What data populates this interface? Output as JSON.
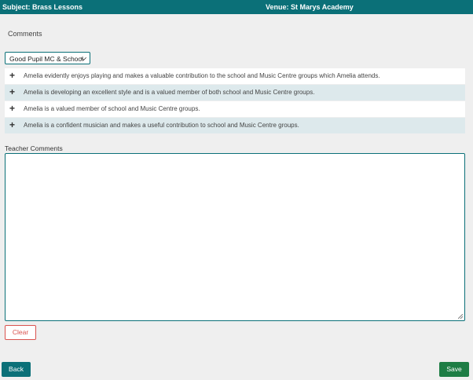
{
  "header": {
    "subject": "Subject: Brass Lessons",
    "venue": "Venue: St Marys Academy"
  },
  "comments": {
    "heading": "Comments",
    "select_value": "Good Pupil MC & School",
    "items": [
      {
        "text": "Amelia evidently enjoys playing and makes a valuable contribution to the school and Music Centre groups which Amelia attends."
      },
      {
        "text": "Amelia is developing an excellent style and is a valued member of both school and Music Centre groups."
      },
      {
        "text": "Amelia is a valued member of school and Music Centre groups."
      },
      {
        "text": "Amelia is a confident musician and makes a useful contribution to school and Music Centre groups."
      }
    ]
  },
  "teacher_comments": {
    "label": "Teacher Comments",
    "value": ""
  },
  "buttons": {
    "clear": "Clear",
    "back": "Back",
    "save": "Save"
  },
  "colors": {
    "header_bg": "#0b7078",
    "save_bg": "#1e7d45",
    "clear_border": "#d9534f"
  }
}
